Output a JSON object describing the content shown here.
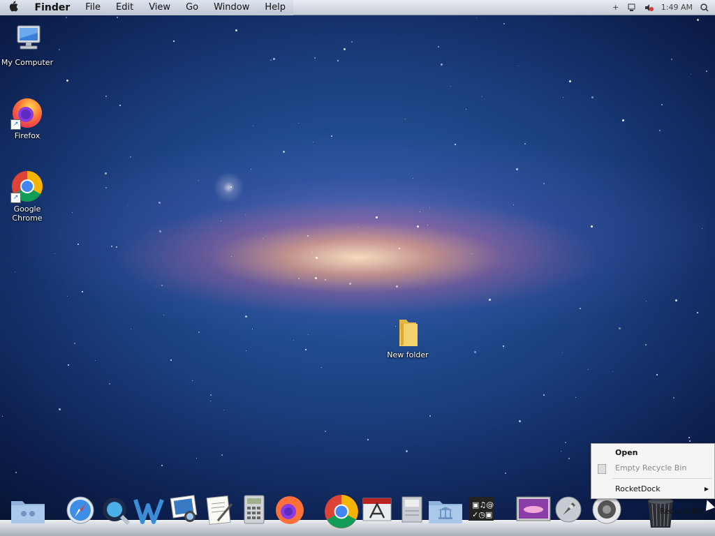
{
  "menubar": {
    "apple": "",
    "items": [
      "Finder",
      "File",
      "Edit",
      "View",
      "Go",
      "Window",
      "Help"
    ],
    "clock": "1:49 AM"
  },
  "desktop": {
    "icons": [
      {
        "label": "My Computer",
        "icon": "computer-icon"
      },
      {
        "label": "Firefox",
        "icon": "firefox-icon"
      },
      {
        "label": "Google Chrome",
        "icon": "chrome-icon"
      },
      {
        "label": "New folder",
        "icon": "folder-icon"
      }
    ]
  },
  "context_menu": {
    "items": [
      {
        "label": "Open",
        "bold": true
      },
      {
        "label": "Empty Recycle Bin",
        "disabled": true
      },
      {
        "label": "RocketDock",
        "submenu": true
      }
    ]
  },
  "dock": {
    "hover_label": "Recycle Bin",
    "items": [
      "users-folder-icon",
      "safari-icon",
      "quicktime-icon",
      "word-icon",
      "iphoto-icon",
      "textedit-icon",
      "calculator-icon",
      "firefox-icon",
      "chrome-icon",
      "app-store-icon",
      "disk-utility-icon",
      "applications-folder-icon",
      "media-icon",
      "wallpaper-icon",
      "launchpad-icon",
      "speaker-icon",
      "recycle-bin-icon"
    ]
  },
  "colors": {
    "chrome_red": "#db4437",
    "chrome_green": "#0f9d58",
    "chrome_yellow": "#f4b400",
    "chrome_blue": "#4285f4",
    "firefox_orange": "#ff7139",
    "folder_yellow": "#f3d26b"
  }
}
